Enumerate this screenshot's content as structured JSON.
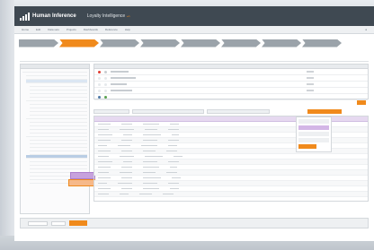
{
  "app": {
    "logo_text": "Human Inference",
    "product_name": "Loyalty Intelligence"
  },
  "menu": {
    "items": [
      "Home",
      "Edit",
      "Data sets",
      "Projects",
      "Dashboards",
      "Reference",
      "Help"
    ]
  },
  "steps": {
    "items": [
      "",
      "",
      "",
      "",
      "",
      "",
      "",
      ""
    ],
    "active_index": 1
  },
  "colors": {
    "header": "#3f4952",
    "accent": "#f08a1c",
    "highlight_purple": "#c7a2dd"
  }
}
